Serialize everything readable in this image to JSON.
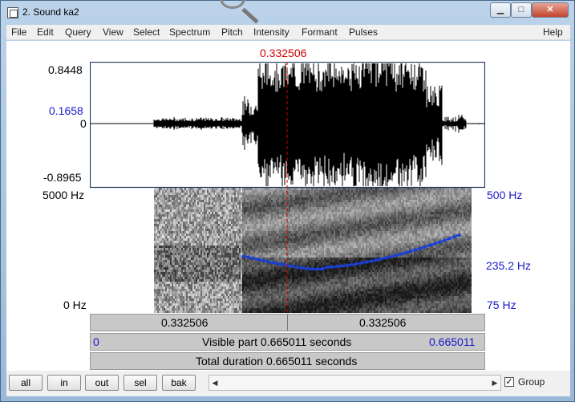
{
  "window": {
    "title": "2. Sound ka2"
  },
  "titlebar_buttons": {
    "minimize": "▁",
    "maximize": "□",
    "close": "✕"
  },
  "menu": [
    "File",
    "Edit",
    "Query",
    "View",
    "Select",
    "Spectrum",
    "Pitch",
    "Intensity",
    "Formant",
    "Pulses",
    "Help"
  ],
  "cursor_time": "0.332506",
  "waveform": {
    "top_value": "0.8448",
    "cursor_value": "0.1658",
    "zero_label": "0",
    "bottom_value": "-0.8965"
  },
  "spectrogram": {
    "top_freq": "5000 Hz",
    "bottom_freq": "0 Hz"
  },
  "pitch": {
    "top": "500 Hz",
    "value": "235.2 Hz",
    "bottom": "75 Hz"
  },
  "time_bar": {
    "left": "0.332506",
    "right": "0.332506"
  },
  "visible_bar": {
    "start": "0",
    "label": "Visible part 0.665011 seconds",
    "end": "0.665011"
  },
  "total_bar": {
    "label": "Total duration 0.665011 seconds"
  },
  "buttons": {
    "all": "all",
    "in": "in",
    "out": "out",
    "sel": "sel",
    "bak": "bak"
  },
  "scrollbar": {
    "left_arrow": "◀",
    "right_arrow": "▶"
  },
  "group": {
    "label": "Group",
    "checked": true,
    "check_glyph": "✓"
  },
  "colors": {
    "pitch_curve": "#1a3fd6",
    "cursor": "#d10000",
    "axis_text": "#1a1acc"
  }
}
